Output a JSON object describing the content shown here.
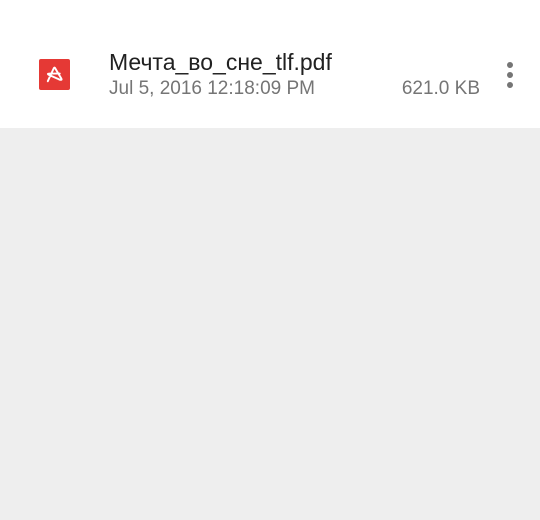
{
  "file": {
    "name": "Мечта_во_сне_tlf.pdf",
    "date": "Jul 5, 2016 12:18:09 PM",
    "size": "621.0 KB",
    "icon": "pdf-file-icon",
    "icon_color": "#e53935"
  },
  "menu": {
    "icon": "more-vert-icon"
  },
  "colors": {
    "background": "#eeeeee",
    "row_background": "#ffffff",
    "primary_text": "#212121",
    "secondary_text": "#757575"
  }
}
